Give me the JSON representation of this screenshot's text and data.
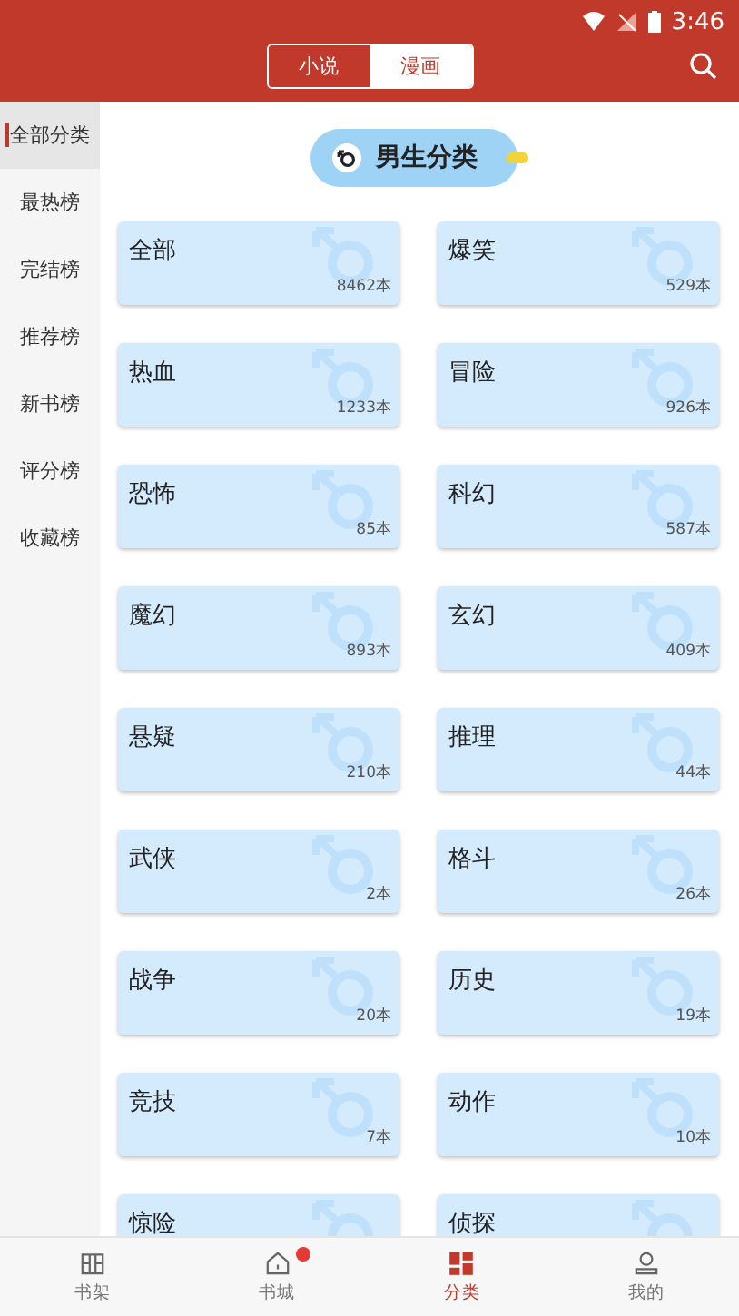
{
  "status_bar": {
    "time": "3:46"
  },
  "header": {
    "tabs": [
      {
        "label": "小说",
        "selected": false
      },
      {
        "label": "漫画",
        "selected": true
      }
    ]
  },
  "sidebar": {
    "items": [
      {
        "label": "全部分类",
        "selected": true
      },
      {
        "label": "最热榜",
        "selected": false
      },
      {
        "label": "完结榜",
        "selected": false
      },
      {
        "label": "推荐榜",
        "selected": false
      },
      {
        "label": "新书榜",
        "selected": false
      },
      {
        "label": "评分榜",
        "selected": false
      },
      {
        "label": "收藏榜",
        "selected": false
      }
    ]
  },
  "section": {
    "title": "男生分类"
  },
  "categories": [
    {
      "name": "全部",
      "count": "8462本"
    },
    {
      "name": "爆笑",
      "count": "529本"
    },
    {
      "name": "热血",
      "count": "1233本"
    },
    {
      "name": "冒险",
      "count": "926本"
    },
    {
      "name": "恐怖",
      "count": "85本"
    },
    {
      "name": "科幻",
      "count": "587本"
    },
    {
      "name": "魔幻",
      "count": "893本"
    },
    {
      "name": "玄幻",
      "count": "409本"
    },
    {
      "name": "悬疑",
      "count": "210本"
    },
    {
      "name": "推理",
      "count": "44本"
    },
    {
      "name": "武侠",
      "count": "2本"
    },
    {
      "name": "格斗",
      "count": "26本"
    },
    {
      "name": "战争",
      "count": "20本"
    },
    {
      "name": "历史",
      "count": "19本"
    },
    {
      "name": "竞技",
      "count": "7本"
    },
    {
      "name": "动作",
      "count": "10本"
    },
    {
      "name": "惊险"
    },
    {
      "name": "侦探"
    }
  ],
  "bottom_nav": [
    {
      "label": "书架",
      "kind": "shelf",
      "selected": false,
      "badge": false
    },
    {
      "label": "书城",
      "kind": "store",
      "selected": false,
      "badge": true
    },
    {
      "label": "分类",
      "kind": "category",
      "selected": true,
      "badge": false
    },
    {
      "label": "我的",
      "kind": "profile",
      "selected": false,
      "badge": false
    }
  ]
}
